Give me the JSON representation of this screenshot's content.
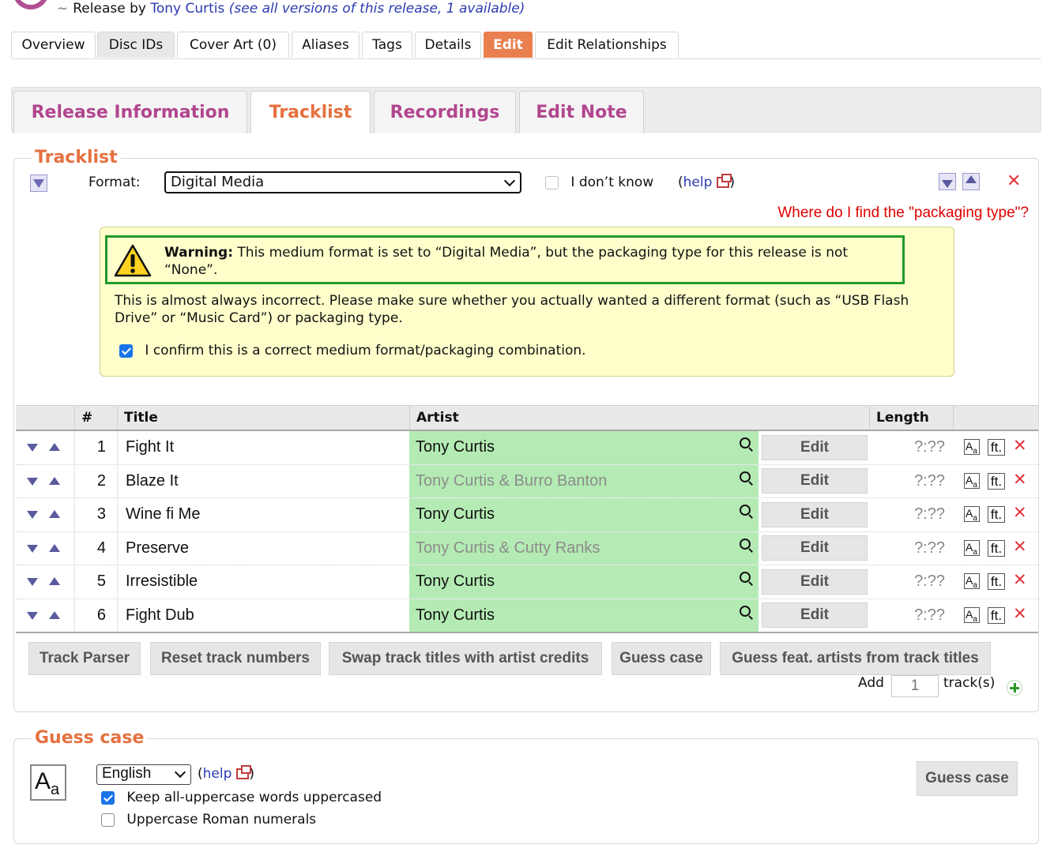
{
  "header": {
    "prefix": "~",
    "byline_text": "Release by",
    "artist": "Tony Curtis",
    "versions_text": "(see all versions of this release, 1 available)"
  },
  "page_tabs": [
    {
      "label": "Overview"
    },
    {
      "label": "Disc IDs"
    },
    {
      "label": "Cover Art (0)"
    },
    {
      "label": "Aliases"
    },
    {
      "label": "Tags"
    },
    {
      "label": "Details"
    },
    {
      "label": "Edit"
    },
    {
      "label": "Edit Relationships"
    }
  ],
  "section_tabs": [
    {
      "label": "Release Information"
    },
    {
      "label": "Tracklist"
    },
    {
      "label": "Recordings"
    },
    {
      "label": "Edit Note"
    }
  ],
  "tracklist": {
    "legend": "Tracklist",
    "format_label": "Format:",
    "format_value": "Digital Media",
    "dont_know_label": "I don’t know",
    "help_open": "(",
    "help_label": "help",
    "help_close": ")",
    "packaging_link": "Where do I find the \"packaging type\"?",
    "warning": {
      "title": "Warning:",
      "text": "This medium format is set to “Digital Media”, but the packaging type for this release is not “None”.",
      "detail": "This is almost always incorrect. Please make sure whether you actually wanted a different format (such as “USB Flash Drive” or “Music Card”) or packaging type.",
      "confirm_label": "I confirm this is a correct medium format/packaging combination."
    },
    "columns": {
      "num": "#",
      "title": "Title",
      "artist": "Artist",
      "length": "Length"
    },
    "tracks": [
      {
        "num": "1",
        "title": "Fight It",
        "artist": "Tony Curtis",
        "edit": "Edit",
        "length": "?:??",
        "ft": "ft."
      },
      {
        "num": "2",
        "title": "Blaze It",
        "artist": "Tony Curtis & Burro Banton",
        "edit": "Edit",
        "length": "?:??",
        "ft": "ft."
      },
      {
        "num": "3",
        "title": "Wine fi Me",
        "artist": "Tony Curtis",
        "edit": "Edit",
        "length": "?:??",
        "ft": "ft."
      },
      {
        "num": "4",
        "title": "Preserve",
        "artist": "Tony Curtis & Cutty Ranks",
        "edit": "Edit",
        "length": "?:??",
        "ft": "ft."
      },
      {
        "num": "5",
        "title": "Irresistible",
        "artist": "Tony Curtis",
        "edit": "Edit",
        "length": "?:??",
        "ft": "ft."
      },
      {
        "num": "6",
        "title": "Fight Dub",
        "artist": "Tony Curtis",
        "edit": "Edit",
        "length": "?:??",
        "ft": "ft."
      }
    ],
    "tools": {
      "track_parser": "Track Parser",
      "reset_numbers": "Reset track numbers",
      "swap_titles": "Swap track titles with artist credits",
      "guess_case": "Guess case",
      "guess_feat": "Guess feat. artists from track titles"
    },
    "add_label": "Add",
    "add_value": "1",
    "tracks_suffix": "track(s)"
  },
  "guess_case": {
    "legend": "Guess case",
    "language": "English",
    "help_open": "(",
    "help_label": "help",
    "help_close": ")",
    "opt_uppercase": "Keep all-uppercase words uppercased",
    "opt_roman": "Uppercase Roman numerals",
    "button": "Guess case"
  },
  "colors": {
    "accent_orange": "#e5713f",
    "accent_purple": "#b1468e",
    "artist_green": "#b4ebb4",
    "warning_bg": "#ffffcc",
    "warning_border": "#1f9a2a",
    "remove_red": "#e0343b"
  }
}
